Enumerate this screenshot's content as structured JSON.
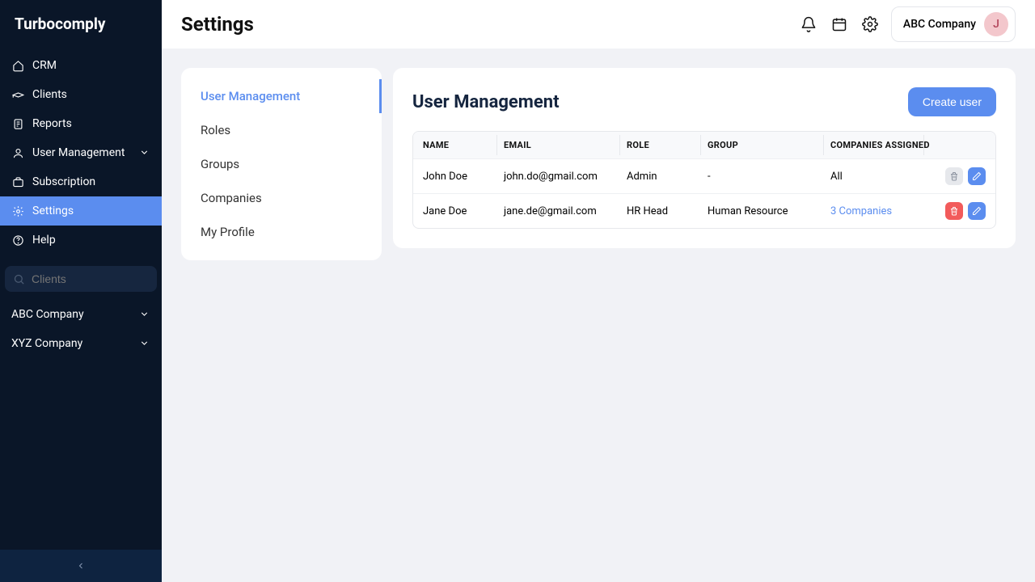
{
  "brand": "Turbocomply",
  "sidebar": {
    "items": [
      {
        "label": "CRM",
        "icon": "home"
      },
      {
        "label": "Clients",
        "icon": "clients"
      },
      {
        "label": "Reports",
        "icon": "reports"
      },
      {
        "label": "User Management",
        "icon": "user",
        "expandable": true
      },
      {
        "label": "Subscription",
        "icon": "subscription"
      },
      {
        "label": "Settings",
        "icon": "settings",
        "active": true
      },
      {
        "label": "Help",
        "icon": "help"
      }
    ],
    "search_placeholder": "Clients",
    "clients": [
      {
        "label": "ABC Company"
      },
      {
        "label": "XYZ Company"
      }
    ]
  },
  "header": {
    "title": "Settings",
    "company": "ABC Company",
    "avatar_letter": "J"
  },
  "subnav": {
    "items": [
      {
        "label": "User Management",
        "active": true
      },
      {
        "label": "Roles"
      },
      {
        "label": "Groups"
      },
      {
        "label": "Companies"
      },
      {
        "label": "My Profile"
      }
    ]
  },
  "panel": {
    "title": "User Management",
    "create_label": "Create user",
    "columns": [
      "NAME",
      "EMAIL",
      "ROLE",
      "GROUP",
      "COMPANIES ASSIGNED"
    ],
    "rows": [
      {
        "name": "John Doe",
        "email": "john.do@gmail.com",
        "role": "Admin",
        "group": "-",
        "companies": "All",
        "companies_link": false,
        "delete_disabled": true
      },
      {
        "name": "Jane Doe",
        "email": "jane.de@gmail.com",
        "role": "HR Head",
        "group": "Human Resource",
        "companies": "3 Companies",
        "companies_link": true,
        "delete_disabled": false
      }
    ]
  }
}
